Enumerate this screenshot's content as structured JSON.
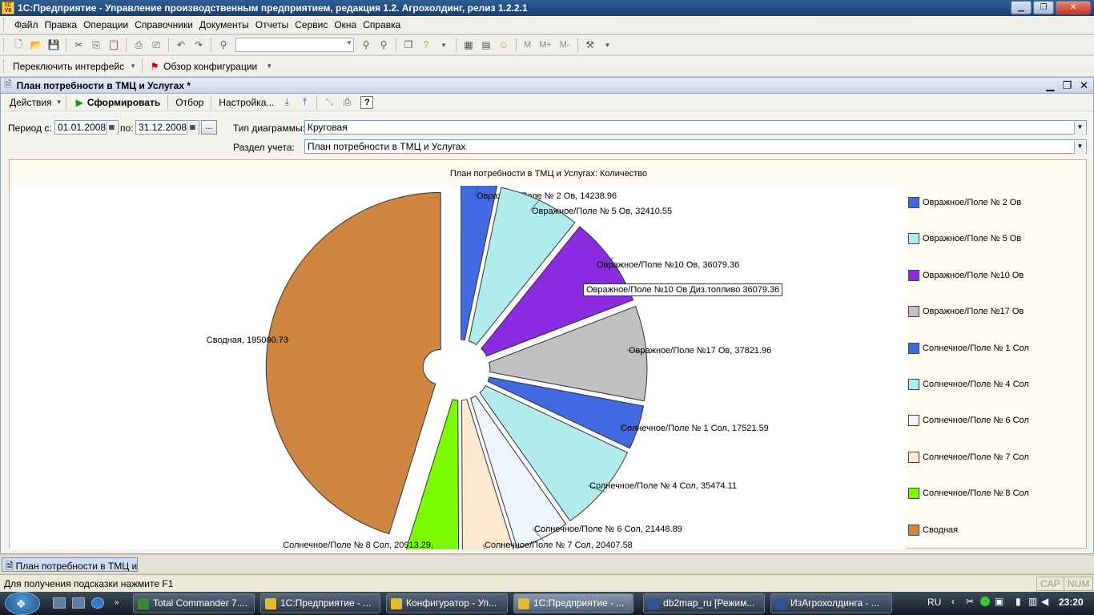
{
  "window": {
    "title": "1С:Предприятие - Управление производственным предприятием, редакция 1.2. Агрохолдинг, релиз 1.2.2.1",
    "app_icon": "1С V8"
  },
  "menu": [
    "Файл",
    "Правка",
    "Операции",
    "Справочники",
    "Документы",
    "Отчеты",
    "Сервис",
    "Окна",
    "Справка"
  ],
  "toolbar2": {
    "switch_interface": "Переключить интерфейс",
    "config_overview": "Обзор конфигурации"
  },
  "toolbar1": {
    "mem_buttons": [
      "M",
      "M+",
      "M-"
    ]
  },
  "document": {
    "title": "План потребности в ТМЦ и Услугах *",
    "actions": "Действия",
    "generate": "Сформировать",
    "filter": "Отбор",
    "settings": "Настройка...",
    "help": "?"
  },
  "form": {
    "period_from_label": "Период с:",
    "period_from": "01.01.2008",
    "period_to_label": "по:",
    "period_to": "31.12.2008",
    "ellipsis": "...",
    "chart_type_label": "Тип диаграммы:",
    "chart_type": "Круговая",
    "section_label": "Раздел учета:",
    "section": "План потребности в ТМЦ и Услугах"
  },
  "chart_data": {
    "type": "pie",
    "title": "План потребности в ТМЦ и Услугах: Количество",
    "slices": [
      {
        "name": "Овражное/Поле  № 2 Ов",
        "value": 14238.96,
        "color": "#4169e1",
        "label": "Овражное/Поле  № 2 Ов, 14238.96"
      },
      {
        "name": "Овражное/Поле  № 5 Ов",
        "value": 32410.55,
        "color": "#b0ecee",
        "label": "Овражное/Поле  № 5 Ов, 32410.55"
      },
      {
        "name": "Овражное/Поле  №10 Ов",
        "value": 36079.36,
        "color": "#8a2be2",
        "label": "Овражное/Поле  №10 Ов, 36079.36"
      },
      {
        "name": "Овражное/Поле №17 Ов",
        "value": 37821.96,
        "color": "#c0c0c0",
        "label": "Овражное/Поле №17 Ов, 37821.96"
      },
      {
        "name": "Солнечное/Поле  № 1 Сол",
        "value": 17521.59,
        "color": "#4169e1",
        "label": "Солнечное/Поле  № 1 Сол, 17521.59"
      },
      {
        "name": "Солнечное/Поле  № 4 Сол",
        "value": 35474.11,
        "color": "#b0ecee",
        "label": "Солнечное/Поле  № 4 Сол, 35474.11"
      },
      {
        "name": "Солнечное/Поле  № 6 Сол",
        "value": 21448.89,
        "color": "#eef4fb",
        "label": "Солнечное/Поле  № 6 Сол, 21448.89"
      },
      {
        "name": "Солнечное/Поле  № 7 Сол",
        "value": 20407.58,
        "color": "#fde9cf",
        "label": "Солнечное/Поле  № 7 Сол, 20407.58"
      },
      {
        "name": "Солнечное/Поле  № 8 Сол",
        "value": 20913.29,
        "color": "#7cfc00",
        "label": "Солнечное/Поле  № 8 Сол, 20913.29"
      },
      {
        "name": "Сводная",
        "value": 195090.73,
        "color": "#cd853f",
        "label": "Сводная, 195090.73"
      }
    ],
    "legend_placement": "right",
    "tooltip": "Овражное/Поле  №10 Ов Диз.топливо 36079.36"
  },
  "window_tab": "План потребности в ТМЦ и ...",
  "status": {
    "hint": "Для получения подсказки нажмите F1",
    "cap": "CAP",
    "num": "NUM"
  },
  "taskbar": {
    "tasks": [
      {
        "label": "Total Commander 7....",
        "color": "#3a8a3a"
      },
      {
        "label": "1С:Предприятие - ...",
        "color": "#e8b830"
      },
      {
        "label": "Конфигуратор - Уп...",
        "color": "#e8b830"
      },
      {
        "label": "1С:Предприятие - ...",
        "color": "#e8b830"
      },
      {
        "label": "db2map_ru [Режим...",
        "color": "#2b579a"
      },
      {
        "label": "ИзАгрохолдинга - ...",
        "color": "#2b579a"
      }
    ],
    "active_index": 3,
    "lang": "RU",
    "clock": "23:20"
  }
}
